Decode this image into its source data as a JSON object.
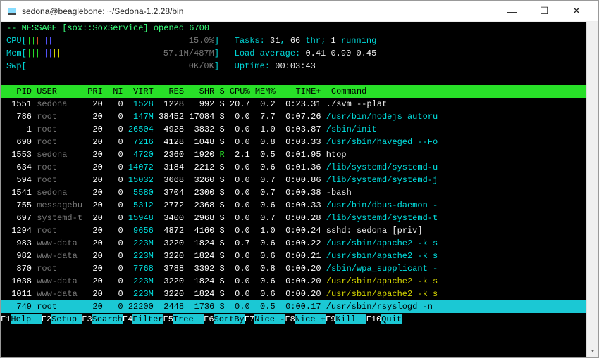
{
  "window": {
    "title": "sedona@beaglebone: ~/Sedona-1.2.28/bin",
    "min_label": "—",
    "max_label": "☐",
    "close_label": "✕"
  },
  "message_line": "-- MESSAGE [sox::SoxService] opened 6700",
  "meters": {
    "cpu": {
      "label": "CPU",
      "bars": "||||||",
      "pct": "15.0%"
    },
    "mem": {
      "label": "Mem",
      "bars": "||||||||",
      "value": "57.1M/487M"
    },
    "swp": {
      "label": "Swp",
      "bars": "",
      "value": "0K/0K"
    }
  },
  "summary": {
    "tasks_label": "Tasks:",
    "tasks_total": "31",
    "tasks_sep": ",",
    "tasks_thr": "66",
    "tasks_thr_label": "thr;",
    "tasks_running": "1",
    "tasks_running_label": "running",
    "load_label": "Load average:",
    "load1": "0.41",
    "load2": "0.90",
    "load3": "0.45",
    "uptime_label": "Uptime:",
    "uptime": "00:03:43"
  },
  "header": {
    "pid": "PID",
    "user": "USER",
    "pri": "PRI",
    "ni": "NI",
    "virt": "VIRT",
    "res": "RES",
    "shr": "SHR",
    "s": "S",
    "cpu": "CPU%",
    "mem": "MEM%",
    "time": "TIME+",
    "cmd": "Command"
  },
  "procs": [
    {
      "pid": "1551",
      "user": "sedona",
      "pri": "20",
      "ni": "0",
      "virt": "1528",
      "res": "1228",
      "shr": "992",
      "s": "S",
      "cpu": "20.7",
      "mem": "0.2",
      "time": "0:23.31",
      "cmd": "./svm --plat",
      "cmdstyle": "plain"
    },
    {
      "pid": "786",
      "user": "root",
      "pri": "20",
      "ni": "0",
      "virt": "147M",
      "res": "38452",
      "shr": "17084",
      "s": "S",
      "cpu": "0.0",
      "mem": "7.7",
      "time": "0:07.26",
      "cmd": "/usr/bin/nodejs autoru",
      "cmdstyle": "cyan"
    },
    {
      "pid": "1",
      "user": "root",
      "pri": "20",
      "ni": "0",
      "virt": "26504",
      "res": "4928",
      "shr": "3832",
      "s": "S",
      "cpu": "0.0",
      "mem": "1.0",
      "time": "0:03.87",
      "cmd": "/sbin/init",
      "cmdstyle": "cyan"
    },
    {
      "pid": "690",
      "user": "root",
      "pri": "20",
      "ni": "0",
      "virt": "7216",
      "res": "4128",
      "shr": "1048",
      "s": "S",
      "cpu": "0.0",
      "mem": "0.8",
      "time": "0:03.33",
      "cmd": "/usr/sbin/haveged --Fo",
      "cmdstyle": "cyan"
    },
    {
      "pid": "1553",
      "user": "sedona",
      "pri": "20",
      "ni": "0",
      "virt": "4720",
      "res": "2360",
      "shr": "1920",
      "s": "R",
      "cpu": "2.1",
      "mem": "0.5",
      "time": "0:01.95",
      "cmd": "htop",
      "cmdstyle": "plain"
    },
    {
      "pid": "634",
      "user": "root",
      "pri": "20",
      "ni": "0",
      "virt": "14072",
      "res": "3184",
      "shr": "2212",
      "s": "S",
      "cpu": "0.0",
      "mem": "0.6",
      "time": "0:01.36",
      "cmd": "/lib/systemd/systemd-u",
      "cmdstyle": "cyan"
    },
    {
      "pid": "594",
      "user": "root",
      "pri": "20",
      "ni": "0",
      "virt": "15032",
      "res": "3668",
      "shr": "3260",
      "s": "S",
      "cpu": "0.0",
      "mem": "0.7",
      "time": "0:00.86",
      "cmd": "/lib/systemd/systemd-j",
      "cmdstyle": "cyan"
    },
    {
      "pid": "1541",
      "user": "sedona",
      "pri": "20",
      "ni": "0",
      "virt": "5580",
      "res": "3704",
      "shr": "2300",
      "s": "S",
      "cpu": "0.0",
      "mem": "0.7",
      "time": "0:00.38",
      "cmd": "-bash",
      "cmdstyle": "plain"
    },
    {
      "pid": "755",
      "user": "messagebu",
      "pri": "20",
      "ni": "0",
      "virt": "5312",
      "res": "2772",
      "shr": "2368",
      "s": "S",
      "cpu": "0.0",
      "mem": "0.6",
      "time": "0:00.33",
      "cmd": "/usr/bin/dbus-daemon -",
      "cmdstyle": "cyan"
    },
    {
      "pid": "697",
      "user": "systemd-t",
      "pri": "20",
      "ni": "0",
      "virt": "15948",
      "res": "3400",
      "shr": "2968",
      "s": "S",
      "cpu": "0.0",
      "mem": "0.7",
      "time": "0:00.28",
      "cmd": "/lib/systemd/systemd-t",
      "cmdstyle": "cyan"
    },
    {
      "pid": "1294",
      "user": "root",
      "pri": "20",
      "ni": "0",
      "virt": "9656",
      "res": "4872",
      "shr": "4160",
      "s": "S",
      "cpu": "0.0",
      "mem": "1.0",
      "time": "0:00.24",
      "cmd": "sshd: sedona [priv]",
      "cmdstyle": "plain"
    },
    {
      "pid": "983",
      "user": "www-data",
      "pri": "20",
      "ni": "0",
      "virt": "223M",
      "res": "3220",
      "shr": "1824",
      "s": "S",
      "cpu": "0.7",
      "mem": "0.6",
      "time": "0:00.22",
      "cmd": "/usr/sbin/apache2 -k s",
      "cmdstyle": "cyan"
    },
    {
      "pid": "982",
      "user": "www-data",
      "pri": "20",
      "ni": "0",
      "virt": "223M",
      "res": "3220",
      "shr": "1824",
      "s": "S",
      "cpu": "0.0",
      "mem": "0.6",
      "time": "0:00.21",
      "cmd": "/usr/sbin/apache2 -k s",
      "cmdstyle": "cyan"
    },
    {
      "pid": "870",
      "user": "root",
      "pri": "20",
      "ni": "0",
      "virt": "7768",
      "res": "3788",
      "shr": "3392",
      "s": "S",
      "cpu": "0.0",
      "mem": "0.8",
      "time": "0:00.20",
      "cmd": "/sbin/wpa_supplicant -",
      "cmdstyle": "cyan"
    },
    {
      "pid": "1038",
      "user": "www-data",
      "pri": "20",
      "ni": "0",
      "virt": "223M",
      "res": "3220",
      "shr": "1824",
      "s": "S",
      "cpu": "0.0",
      "mem": "0.6",
      "time": "0:00.20",
      "cmd": "/usr/sbin/apache2 -k s",
      "cmdstyle": "yellow"
    },
    {
      "pid": "1011",
      "user": "www-data",
      "pri": "20",
      "ni": "0",
      "virt": "223M",
      "res": "3220",
      "shr": "1824",
      "s": "S",
      "cpu": "0.0",
      "mem": "0.6",
      "time": "0:00.20",
      "cmd": "/usr/sbin/apache2 -k s",
      "cmdstyle": "yellow"
    },
    {
      "pid": "749",
      "user": "root",
      "pri": "20",
      "ni": "0",
      "virt": "22200",
      "res": "2448",
      "shr": "1736",
      "s": "S",
      "cpu": "0.0",
      "mem": "0.5",
      "time": "0:00.17",
      "cmd": "/usr/sbin/rsyslogd -n",
      "cmdstyle": "cyan",
      "hl": true
    }
  ],
  "fkeys": [
    {
      "k": "F1",
      "l": "Help  "
    },
    {
      "k": "F2",
      "l": "Setup "
    },
    {
      "k": "F3",
      "l": "Search"
    },
    {
      "k": "F4",
      "l": "Filter"
    },
    {
      "k": "F5",
      "l": "Tree  "
    },
    {
      "k": "F6",
      "l": "SortBy"
    },
    {
      "k": "F7",
      "l": "Nice -"
    },
    {
      "k": "F8",
      "l": "Nice +"
    },
    {
      "k": "F9",
      "l": "Kill  "
    },
    {
      "k": "F10",
      "l": "Quit"
    }
  ]
}
